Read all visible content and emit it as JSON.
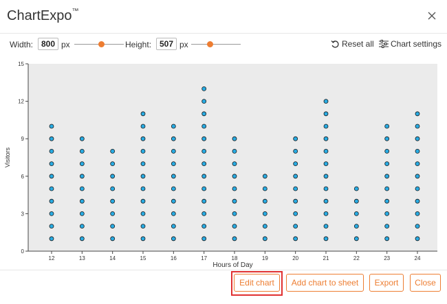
{
  "window": {
    "title": "ChartExpo",
    "trademark": "™",
    "close_icon": "close-icon"
  },
  "toolbar": {
    "width_label": "Width:",
    "width_value": "800",
    "width_unit": "px",
    "height_label": "Height:",
    "height_value": "507",
    "height_unit": "px",
    "reset_label": "Reset all",
    "settings_label": "Chart settings",
    "slider_color": "#ed7d31"
  },
  "footer": {
    "edit_label": "Edit chart",
    "add_label": "Add chart to sheet",
    "export_label": "Export",
    "close_label": "Close",
    "accent": "#ed7d31",
    "highlight": "#e03030"
  },
  "chart_data": {
    "type": "scatter",
    "title": "",
    "xlabel": "Hours of Day",
    "ylabel": "Visitors",
    "categories": [
      "12",
      "13",
      "14",
      "15",
      "16",
      "17",
      "18",
      "19",
      "20",
      "21",
      "22",
      "23",
      "24"
    ],
    "values": [
      10,
      9,
      8,
      11,
      10,
      13,
      9,
      6,
      9,
      12,
      5,
      10,
      11
    ],
    "y_ticks": [
      0,
      3,
      6,
      9,
      12,
      15
    ],
    "ylim": [
      0,
      15
    ],
    "grid": false,
    "plot_background": "#ebebeb",
    "marker_fill": "#29abe2",
    "marker_stroke": "#1a1a1a"
  }
}
